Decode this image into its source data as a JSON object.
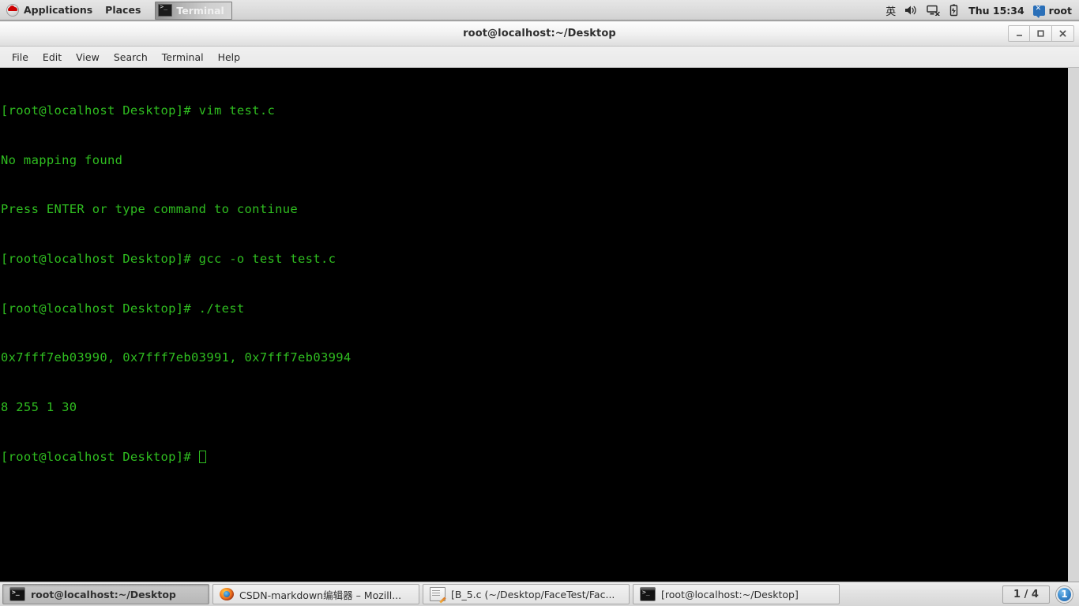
{
  "top_panel": {
    "logo_icon": "redhat-logo-icon",
    "menus": [
      {
        "label": "Applications",
        "name": "applications-menu"
      },
      {
        "label": "Places",
        "name": "places-menu"
      }
    ],
    "window_list": [
      {
        "label": "Terminal",
        "icon": "terminal-icon",
        "active": true
      }
    ],
    "tray": {
      "input_method": "英",
      "volume_icon": "speaker-icon",
      "network_icon": "network-disconnected-icon",
      "battery_icon": "battery-charging-icon",
      "clock": "Thu 15:34",
      "user_icon": "user-session-icon",
      "user": "root"
    }
  },
  "window": {
    "title": "root@localhost:~/Desktop",
    "buttons": {
      "minimize": "minimize-button",
      "maximize": "maximize-button",
      "close": "close-button"
    },
    "menubar": [
      {
        "label": "File"
      },
      {
        "label": "Edit"
      },
      {
        "label": "View"
      },
      {
        "label": "Search"
      },
      {
        "label": "Terminal"
      },
      {
        "label": "Help"
      }
    ]
  },
  "terminal": {
    "foreground_color": "#2fbd20",
    "background_color": "#000000",
    "lines": [
      "[root@localhost Desktop]# vim test.c",
      "No mapping found",
      "Press ENTER or type command to continue",
      "[root@localhost Desktop]# gcc -o test test.c",
      "[root@localhost Desktop]# ./test",
      "0x7fff7eb03990, 0x7fff7eb03991, 0x7fff7eb03994",
      "8 255 1 30"
    ],
    "prompt": "[root@localhost Desktop]# ",
    "cursor": "block-outline-cursor"
  },
  "bottom_panel": {
    "tasks": [
      {
        "label": "root@localhost:~/Desktop",
        "icon": "terminal-icon",
        "active": true
      },
      {
        "label": "CSDN-markdown编辑器 – Mozill...",
        "icon": "firefox-icon",
        "active": false
      },
      {
        "label": "[B_5.c (~/Desktop/FaceTest/Fac...",
        "icon": "gedit-icon",
        "active": false
      },
      {
        "label": "[root@localhost:~/Desktop]",
        "icon": "terminal-icon",
        "active": false
      }
    ],
    "workspace_switcher": "1 / 4",
    "notification_count": "1"
  }
}
